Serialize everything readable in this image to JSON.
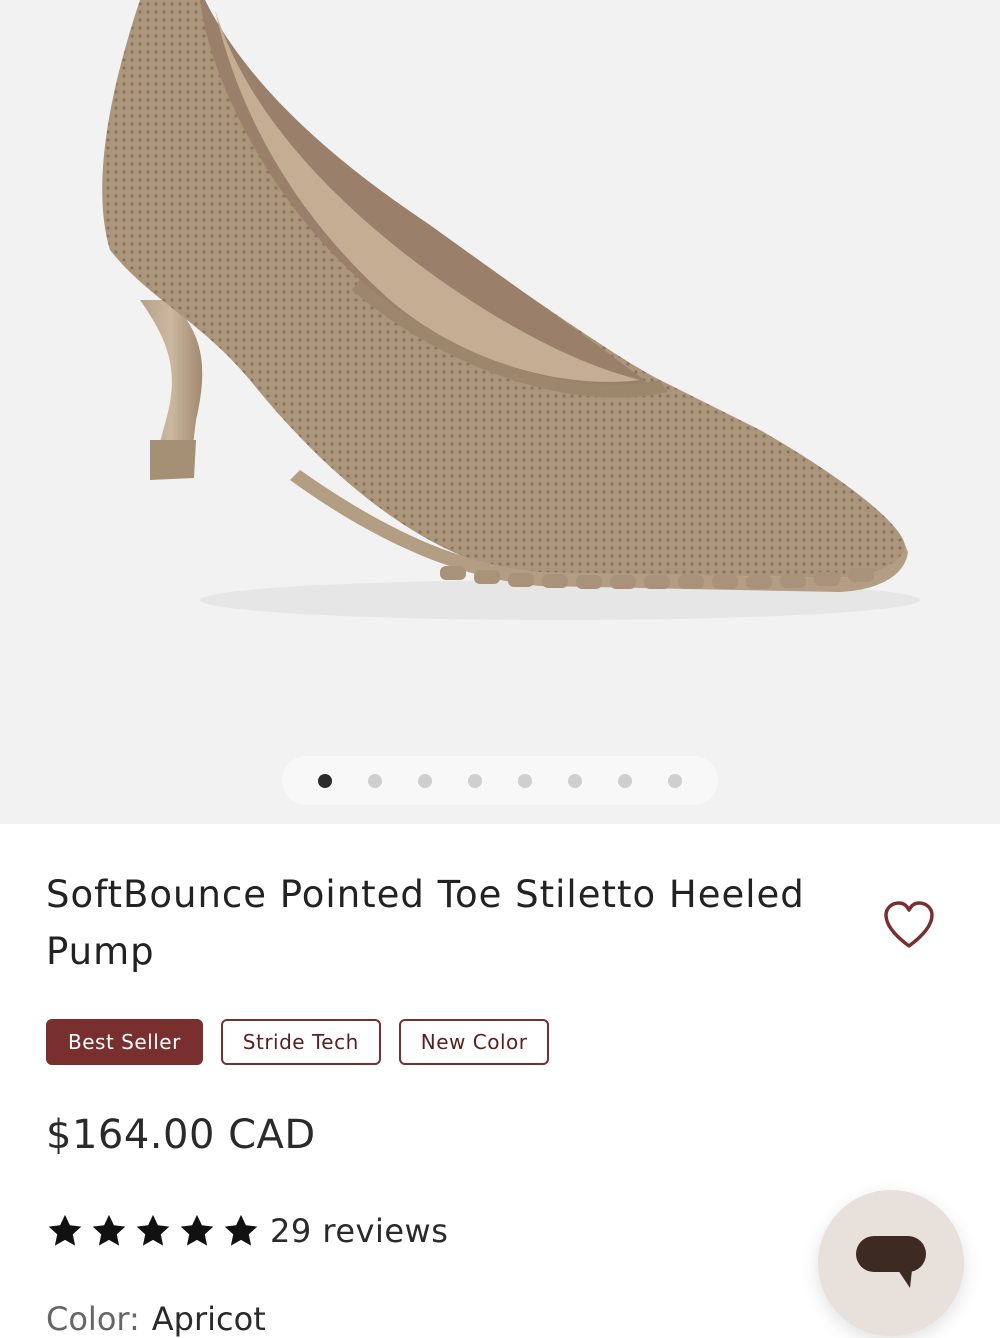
{
  "gallery": {
    "image_alt": "Apricot knit pointed toe stiletto pump",
    "slide_count": 8,
    "active_slide": 1
  },
  "product": {
    "title": "SoftBounce Pointed Toe Stiletto Heeled Pump",
    "badges": [
      "Best Seller",
      "Stride Tech",
      "New Color"
    ],
    "price": "$164.00 CAD",
    "rating": 5,
    "reviews": "29 reviews",
    "color_label": "Color:",
    "color_value": "Apricot"
  },
  "icons": {
    "wishlist": "heart-outline-icon",
    "star": "star-filled-icon",
    "chat": "chat-bubble-icon"
  },
  "colors": {
    "brand": "#7a2f2f",
    "shoe": "#b09a80",
    "chat_bg": "#e8e0db"
  }
}
